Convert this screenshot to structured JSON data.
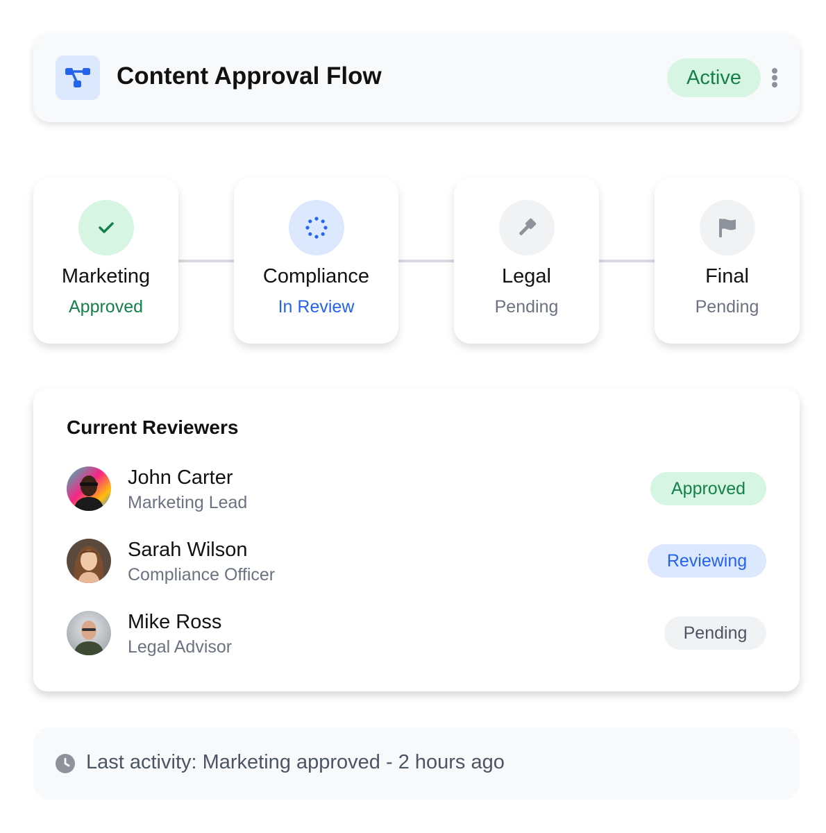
{
  "header": {
    "title": "Content Approval Flow",
    "status": "Active",
    "icon": "workflow-icon"
  },
  "stages": [
    {
      "name": "Marketing",
      "status": "Approved",
      "icon": "check-icon",
      "state": "approved"
    },
    {
      "name": "Compliance",
      "status": "In Review",
      "icon": "spinner-icon",
      "state": "review"
    },
    {
      "name": "Legal",
      "status": "Pending",
      "icon": "gavel-icon",
      "state": "pending"
    },
    {
      "name": "Final",
      "status": "Pending",
      "icon": "flag-icon",
      "state": "pending"
    }
  ],
  "reviewers": {
    "title": "Current Reviewers",
    "items": [
      {
        "name": "John Carter",
        "role": "Marketing Lead",
        "status": "Approved",
        "state": "approved"
      },
      {
        "name": "Sarah Wilson",
        "role": "Compliance Officer",
        "status": "Reviewing",
        "state": "review"
      },
      {
        "name": "Mike Ross",
        "role": "Legal Advisor",
        "status": "Pending",
        "state": "pending"
      }
    ]
  },
  "activity": {
    "text": "Last activity: Marketing approved - 2 hours ago",
    "icon": "clock-icon"
  },
  "colors": {
    "approved_bg": "#d7f5e3",
    "approved_fg": "#14804a",
    "review_bg": "#dbe8fd",
    "review_fg": "#2563eb",
    "pending_bg": "#f1f2f4",
    "pending_fg": "#6b7280"
  }
}
